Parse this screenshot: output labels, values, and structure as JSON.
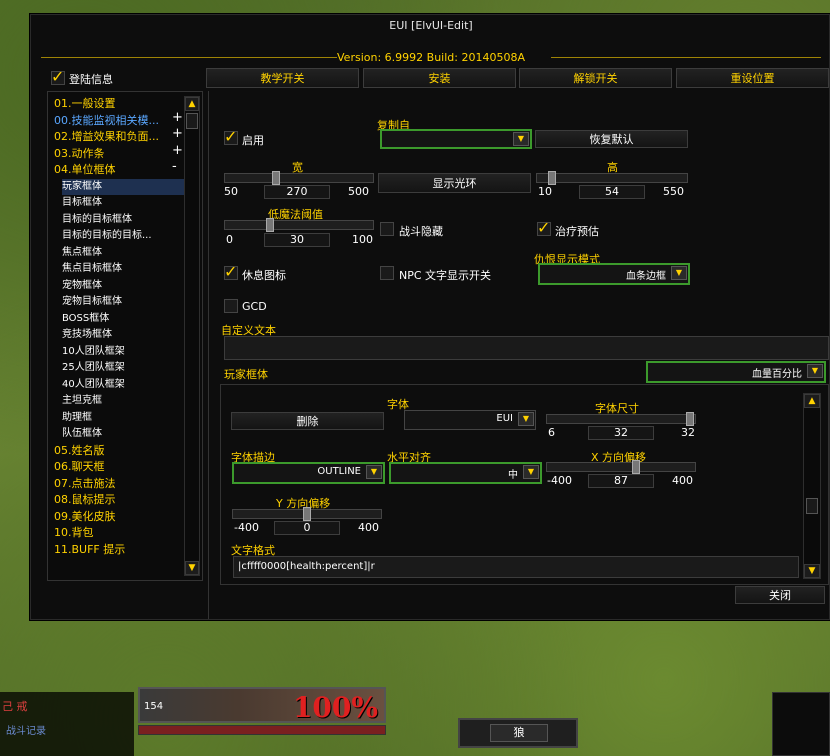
{
  "window": {
    "title": "EUI [ElvUI-Edit]",
    "version": "Version: 6.9992 Build: 20140508A"
  },
  "top": {
    "login_info_label": "登陆信息",
    "login_info_checked": true,
    "buttons": [
      "教学开关",
      "安装",
      "解锁开关",
      "重设位置"
    ]
  },
  "sidebar": {
    "items": [
      {
        "label": "01.一般设置",
        "type": "cat",
        "toggle": ""
      },
      {
        "label": "00.技能监视相关模...",
        "type": "cat-active",
        "toggle": "+"
      },
      {
        "label": "02.增益效果和负面...",
        "type": "cat",
        "toggle": "+"
      },
      {
        "label": "03.动作条",
        "type": "cat",
        "toggle": "+"
      },
      {
        "label": "04.单位框体",
        "type": "cat",
        "toggle": "-"
      },
      {
        "label": "玩家框体",
        "type": "sub",
        "toggle": ""
      },
      {
        "label": "目标框体",
        "type": "sub",
        "toggle": ""
      },
      {
        "label": "目标的目标框体",
        "type": "sub",
        "toggle": ""
      },
      {
        "label": "目标的目标的目标...",
        "type": "sub",
        "toggle": ""
      },
      {
        "label": "焦点框体",
        "type": "sub",
        "toggle": ""
      },
      {
        "label": "焦点目标框体",
        "type": "sub",
        "toggle": ""
      },
      {
        "label": "宠物框体",
        "type": "sub",
        "toggle": ""
      },
      {
        "label": "宠物目标框体",
        "type": "sub",
        "toggle": ""
      },
      {
        "label": "BOSS框体",
        "type": "sub",
        "toggle": ""
      },
      {
        "label": "竞技场框体",
        "type": "sub",
        "toggle": ""
      },
      {
        "label": "10人团队框架",
        "type": "sub",
        "toggle": ""
      },
      {
        "label": "25人团队框架",
        "type": "sub",
        "toggle": ""
      },
      {
        "label": "40人团队框架",
        "type": "sub",
        "toggle": ""
      },
      {
        "label": "主坦克框",
        "type": "sub",
        "toggle": ""
      },
      {
        "label": "助理框",
        "type": "sub",
        "toggle": ""
      },
      {
        "label": "队伍框体",
        "type": "sub",
        "toggle": ""
      },
      {
        "label": "05.姓名版",
        "type": "cat",
        "toggle": ""
      },
      {
        "label": "06.聊天框",
        "type": "cat",
        "toggle": ""
      },
      {
        "label": "07.点击施法",
        "type": "cat",
        "toggle": ""
      },
      {
        "label": "08.鼠标提示",
        "type": "cat",
        "toggle": ""
      },
      {
        "label": "09.美化皮肤",
        "type": "cat",
        "toggle": ""
      },
      {
        "label": "10.背包",
        "type": "cat",
        "toggle": ""
      },
      {
        "label": "11.BUFF 提示",
        "type": "cat",
        "toggle": ""
      }
    ]
  },
  "content": {
    "enable_label": "启用",
    "enable_checked": true,
    "copy_from_label": "复制自",
    "copy_from_value": "",
    "restore_defaults": "恢复默认",
    "width": {
      "label": "宽",
      "min": "50",
      "value": "270",
      "max": "500"
    },
    "show_aura": "显示光环",
    "height": {
      "label": "高",
      "min": "10",
      "value": "54",
      "max": "550"
    },
    "low_mana": {
      "label": "低魔法阈值",
      "min": "0",
      "value": "30",
      "max": "100"
    },
    "combat_hide": {
      "label": "战斗隐藏",
      "checked": false
    },
    "heal_predict": {
      "label": "治疗预估",
      "checked": true
    },
    "rest_icon": {
      "label": "休息图标",
      "checked": true
    },
    "npc_text": {
      "label": "NPC 文字显示开关",
      "checked": false
    },
    "threat_mode": {
      "label": "仇恨显示模式",
      "value": "血条边框"
    },
    "gcd": {
      "label": "GCD",
      "checked": false
    },
    "custom_text_label": "自定义文本",
    "custom_text_value": "",
    "frame_label": "玩家框体",
    "frame_value": "血量百分比",
    "sub": {
      "delete": "删除",
      "font_label": "字体",
      "font_value": "EUI",
      "font_size": {
        "label": "字体尺寸",
        "min": "6",
        "value": "32",
        "max": "32"
      },
      "outline": {
        "label": "字体描边",
        "value": "OUTLINE"
      },
      "justify": {
        "label": "水平对齐",
        "value": "中"
      },
      "x_offset": {
        "label": "X 方向偏移",
        "min": "-400",
        "value": "87",
        "max": "400"
      },
      "y_offset": {
        "label": "Y 方向偏移",
        "min": "-400",
        "value": "0",
        "max": "400"
      },
      "format_label": "文字格式",
      "format_value": "|cffff0000[health:percent]|r"
    },
    "close": "关闭"
  },
  "hud": {
    "level": "154",
    "health_pct": "100%",
    "action_label": "狼",
    "chat_line1": "己  戒",
    "chat_line2": "战斗记录"
  }
}
